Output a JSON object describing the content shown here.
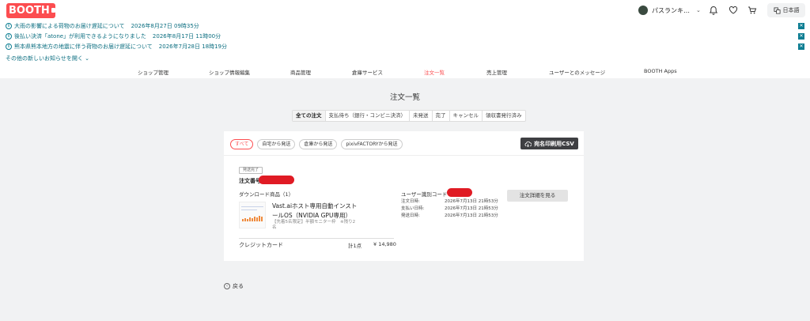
{
  "header": {
    "logo": "BOOTH",
    "user_name": "パスランキ…",
    "language": "日本語"
  },
  "notices": [
    {
      "title": "大雨の影響による荷物のお届け遅延について",
      "date": "2026年8月27日 09時35分"
    },
    {
      "title": "後払い決済「atone」が利用できるようになりました",
      "date": "2026年8月17日 11時00分"
    },
    {
      "title": "熊本県熊本地方の地震に伴う荷物のお届け遅延について",
      "date": "2026年7月28日 18時19分"
    }
  ],
  "more_notices": "その他の新しいお知らせを開く",
  "nav": [
    "ショップ管理",
    "ショップ情報編集",
    "商品管理",
    "倉庫サービス",
    "注文一覧",
    "売上管理",
    "ユーザーとのメッセージ",
    "BOOTH Apps"
  ],
  "page_title": "注文一覧",
  "status_tabs": [
    "全ての注文",
    "支払待ち（銀行・コンビニ決済）",
    "未発送",
    "完了",
    "キャンセル",
    "領収書発行済み"
  ],
  "ship_filters": [
    "すべて",
    "自宅から発送",
    "倉庫から発送",
    "pixivFACTORYから発送"
  ],
  "csv_button": "宛名印刷用CSV",
  "order": {
    "status_badge": "発送完了",
    "order_number_label": "注文番号",
    "download_heading": "ダウンロード商品（1）",
    "product_name": "Vast.aiホスト専用自動インストールOS（NVIDIA GPU専用）",
    "product_variation": "【先着5名限定】半額モニター枠　※残り2名",
    "payment_method": "クレジットカード",
    "quantity": "計1点",
    "price": "¥ 14,980",
    "user_id_label": "ユーザー識別コード",
    "dates": [
      {
        "label": "注文日時:",
        "value": "2026年7月13日 21時53分"
      },
      {
        "label": "支払い日時:",
        "value": "2026年7月13日 21時53分"
      },
      {
        "label": "発送日時:",
        "value": "2026年7月13日 21時53分"
      }
    ],
    "detail_button": "注文詳細を見る"
  },
  "back_link": "戻る",
  "colors": {
    "brand": "#fc4d50",
    "notice": "#0b7d92",
    "dark_button": "#3e3f42"
  }
}
